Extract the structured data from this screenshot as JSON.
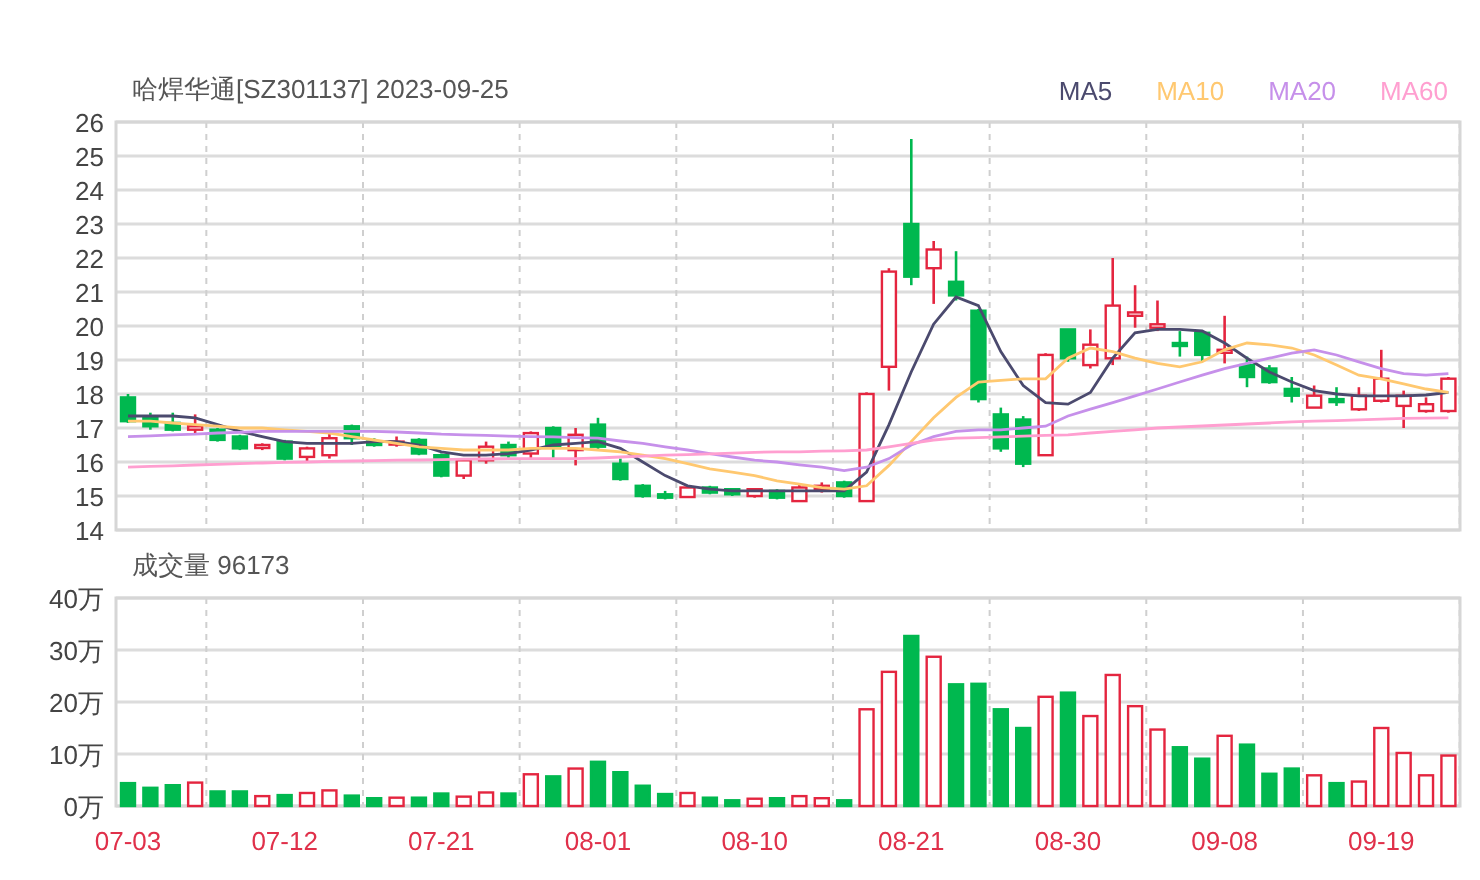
{
  "price_chart": {
    "chart_data": {
      "type": "candlestick",
      "title": "哈焊华通[SZ301137] 2023-09-25",
      "grid": true,
      "ylim": [
        14,
        26
      ],
      "yticks": [
        14,
        15,
        16,
        17,
        18,
        19,
        20,
        21,
        22,
        23,
        24,
        25,
        26
      ],
      "categories": [
        null,
        null,
        null,
        null,
        null,
        null,
        null,
        null,
        null,
        null,
        null,
        null,
        null,
        null,
        null,
        null,
        null,
        null,
        null,
        null,
        null,
        null,
        null,
        null,
        null,
        null,
        null,
        null,
        null,
        null,
        null,
        null,
        null,
        null,
        null,
        null,
        null,
        null,
        null,
        null,
        null,
        null,
        null,
        null,
        null,
        null,
        null,
        null,
        null,
        null,
        null,
        null,
        null,
        null,
        null,
        null,
        null,
        null,
        null,
        null
      ],
      "ohlc": [
        [
          17.9,
          18.0,
          17.15,
          17.2
        ],
        [
          17.3,
          17.45,
          16.95,
          17.05
        ],
        [
          17.15,
          17.45,
          16.9,
          16.95
        ],
        [
          16.95,
          17.4,
          16.85,
          17.05
        ],
        [
          16.95,
          17.0,
          16.6,
          16.65
        ],
        [
          16.75,
          16.8,
          16.35,
          16.4
        ],
        [
          16.45,
          16.55,
          16.35,
          16.5
        ],
        [
          16.6,
          16.65,
          16.05,
          16.1
        ],
        [
          16.15,
          16.45,
          16.0,
          16.4
        ],
        [
          16.2,
          16.9,
          16.1,
          16.7
        ],
        [
          17.05,
          17.1,
          16.5,
          16.7
        ],
        [
          16.6,
          16.7,
          16.45,
          16.5
        ],
        [
          16.55,
          16.75,
          16.45,
          16.6
        ],
        [
          16.65,
          16.7,
          16.2,
          16.25
        ],
        [
          16.2,
          16.25,
          15.55,
          15.6
        ],
        [
          15.6,
          16.05,
          15.5,
          16.05
        ],
        [
          16.05,
          16.6,
          15.95,
          16.45
        ],
        [
          16.5,
          16.6,
          16.1,
          16.2
        ],
        [
          16.25,
          16.9,
          16.1,
          16.85
        ],
        [
          17.0,
          17.05,
          16.1,
          16.45
        ],
        [
          16.35,
          17.0,
          15.9,
          16.8
        ],
        [
          17.1,
          17.3,
          16.35,
          16.45
        ],
        [
          15.95,
          16.1,
          15.45,
          15.5
        ],
        [
          15.3,
          15.35,
          14.95,
          15.0
        ],
        [
          15.05,
          15.15,
          14.9,
          14.95
        ],
        [
          14.97,
          15.25,
          14.95,
          15.25
        ],
        [
          15.25,
          15.3,
          15.05,
          15.1
        ],
        [
          15.2,
          15.2,
          15.0,
          15.05
        ],
        [
          15.0,
          15.2,
          14.95,
          15.2
        ],
        [
          15.15,
          15.2,
          14.9,
          14.95
        ],
        [
          14.85,
          15.35,
          14.85,
          15.25
        ],
        [
          15.2,
          15.4,
          15.1,
          15.3
        ],
        [
          15.4,
          15.45,
          14.95,
          15.0
        ],
        [
          14.85,
          18.05,
          14.85,
          18.0
        ],
        [
          18.8,
          21.7,
          18.1,
          21.6
        ],
        [
          23.0,
          25.5,
          21.2,
          21.45
        ],
        [
          21.7,
          22.5,
          20.65,
          22.25
        ],
        [
          21.3,
          22.2,
          20.75,
          20.9
        ],
        [
          20.45,
          20.5,
          17.75,
          17.85
        ],
        [
          17.4,
          17.6,
          16.3,
          16.4
        ],
        [
          17.25,
          17.35,
          15.85,
          15.95
        ],
        [
          16.2,
          19.2,
          16.2,
          19.15
        ],
        [
          19.9,
          19.9,
          18.95,
          19.05
        ],
        [
          18.85,
          19.9,
          18.75,
          19.45
        ],
        [
          19.05,
          22.0,
          18.85,
          20.6
        ],
        [
          20.3,
          21.2,
          19.95,
          20.4
        ],
        [
          19.95,
          20.75,
          19.85,
          20.05
        ],
        [
          19.5,
          19.85,
          19.1,
          19.45
        ],
        [
          19.8,
          19.85,
          18.95,
          19.15
        ],
        [
          19.25,
          20.3,
          18.9,
          19.3
        ],
        [
          18.85,
          19.1,
          18.2,
          18.5
        ],
        [
          18.75,
          18.85,
          18.3,
          18.35
        ],
        [
          18.15,
          18.5,
          17.75,
          17.95
        ],
        [
          17.6,
          18.25,
          17.6,
          17.95
        ],
        [
          17.85,
          18.2,
          17.65,
          17.8
        ],
        [
          17.55,
          18.2,
          17.5,
          17.95
        ],
        [
          17.8,
          19.3,
          17.75,
          18.45
        ],
        [
          17.65,
          18.1,
          17.0,
          17.95
        ],
        [
          17.5,
          17.9,
          17.45,
          17.7
        ],
        [
          17.5,
          18.5,
          17.45,
          18.45
        ]
      ],
      "series": [
        {
          "name": "MA5",
          "type": "line",
          "color": "#4b4a6e",
          "values": [
            17.35,
            17.35,
            17.35,
            17.3,
            17.1,
            16.9,
            16.75,
            16.6,
            16.55,
            16.55,
            16.55,
            16.6,
            16.6,
            16.5,
            16.3,
            16.2,
            16.2,
            16.25,
            16.35,
            16.5,
            16.55,
            16.6,
            16.4,
            16.0,
            15.6,
            15.3,
            15.2,
            15.15,
            15.15,
            15.15,
            15.15,
            15.15,
            15.15,
            15.7,
            17.1,
            18.65,
            20.05,
            20.85,
            20.6,
            19.25,
            18.25,
            17.75,
            17.7,
            18.05,
            19.05,
            19.8,
            19.9,
            19.9,
            19.85,
            19.5,
            19.05,
            18.65,
            18.35,
            18.1,
            18.0,
            17.95,
            17.95,
            17.95,
            17.97,
            18.05
          ]
        },
        {
          "name": "MA10",
          "type": "line",
          "color": "#ffc870",
          "values": [
            17.2,
            17.2,
            17.15,
            17.1,
            17.05,
            17.0,
            17.0,
            16.95,
            16.9,
            16.85,
            16.75,
            16.65,
            16.55,
            16.45,
            16.4,
            16.35,
            16.35,
            16.35,
            16.4,
            16.4,
            16.4,
            16.35,
            16.3,
            16.2,
            16.1,
            15.95,
            15.8,
            15.7,
            15.6,
            15.45,
            15.35,
            15.25,
            15.2,
            15.3,
            15.9,
            16.6,
            17.3,
            17.9,
            18.35,
            18.4,
            18.45,
            18.45,
            19.05,
            19.35,
            19.25,
            19.05,
            18.9,
            18.8,
            18.95,
            19.3,
            19.5,
            19.45,
            19.35,
            19.15,
            18.85,
            18.55,
            18.45,
            18.3,
            18.15,
            18.05
          ]
        },
        {
          "name": "MA20",
          "type": "line",
          "color": "#c690ea",
          "values": [
            16.75,
            16.77,
            16.8,
            16.82,
            16.85,
            16.87,
            16.9,
            16.9,
            16.9,
            16.9,
            16.9,
            16.9,
            16.88,
            16.85,
            16.82,
            16.8,
            16.78,
            16.76,
            16.75,
            16.74,
            16.72,
            16.7,
            16.62,
            16.55,
            16.45,
            16.35,
            16.25,
            16.15,
            16.05,
            16.0,
            15.92,
            15.85,
            15.75,
            15.85,
            16.1,
            16.5,
            16.75,
            16.9,
            16.95,
            16.95,
            17.0,
            17.05,
            17.35,
            17.55,
            17.75,
            17.95,
            18.15,
            18.35,
            18.55,
            18.75,
            18.9,
            19.05,
            19.2,
            19.3,
            19.15,
            18.95,
            18.75,
            18.6,
            18.55,
            18.6
          ]
        },
        {
          "name": "MA60",
          "type": "line",
          "color": "#ff9fd0",
          "values": [
            15.85,
            15.87,
            15.89,
            15.91,
            15.93,
            15.95,
            15.97,
            15.99,
            16.0,
            16.02,
            16.03,
            16.04,
            16.05,
            16.06,
            16.07,
            16.08,
            16.09,
            16.1,
            16.1,
            16.1,
            16.1,
            16.12,
            16.15,
            16.17,
            16.2,
            16.22,
            16.24,
            16.26,
            16.28,
            16.3,
            16.3,
            16.32,
            16.33,
            16.35,
            16.45,
            16.55,
            16.65,
            16.7,
            16.72,
            16.74,
            16.76,
            16.78,
            16.8,
            16.85,
            16.9,
            16.95,
            17.0,
            17.03,
            17.06,
            17.09,
            17.12,
            17.15,
            17.18,
            17.2,
            17.22,
            17.24,
            17.26,
            17.28,
            17.29,
            17.3
          ]
        }
      ]
    }
  },
  "volume_chart": {
    "chart_data": {
      "type": "bar",
      "title": "成交量 96173",
      "grid": true,
      "ylim": [
        0,
        40
      ],
      "yticks": [
        {
          "value": 0,
          "label": "0万"
        },
        {
          "value": 10,
          "label": "10万"
        },
        {
          "value": 20,
          "label": "20万"
        },
        {
          "value": 30,
          "label": "30万"
        },
        {
          "value": 40,
          "label": "40万"
        }
      ],
      "categories": [
        "07-03",
        null,
        null,
        null,
        null,
        null,
        null,
        "07-12",
        null,
        null,
        null,
        null,
        null,
        null,
        "07-21",
        null,
        null,
        null,
        null,
        null,
        null,
        "08-01",
        null,
        null,
        null,
        null,
        null,
        null,
        "08-10",
        null,
        null,
        null,
        null,
        null,
        null,
        "08-21",
        null,
        null,
        null,
        null,
        null,
        null,
        "08-30",
        null,
        null,
        null,
        null,
        null,
        null,
        "09-08",
        null,
        null,
        null,
        null,
        null,
        null,
        "09-19",
        null,
        null,
        null
      ],
      "values": [
        4.4,
        3.5,
        4.0,
        4.5,
        2.8,
        2.8,
        1.9,
        2.1,
        2.5,
        3.0,
        2.0,
        1.5,
        1.6,
        1.6,
        2.4,
        1.8,
        2.6,
        2.4,
        6.1,
        5.7,
        7.2,
        8.5,
        6.5,
        3.9,
        2.3,
        2.5,
        1.6,
        1.1,
        1.4,
        1.5,
        1.9,
        1.5,
        1.1,
        18.6,
        25.8,
        32.7,
        28.7,
        23.4,
        23.5,
        18.6,
        15.0,
        21.0,
        21.8,
        17.3,
        25.2,
        19.2,
        14.7,
        11.3,
        9.1,
        13.5,
        11.8,
        6.2,
        7.2,
        5.9,
        4.4,
        4.7,
        15.0,
        10.2,
        5.9,
        9.7
      ]
    }
  }
}
